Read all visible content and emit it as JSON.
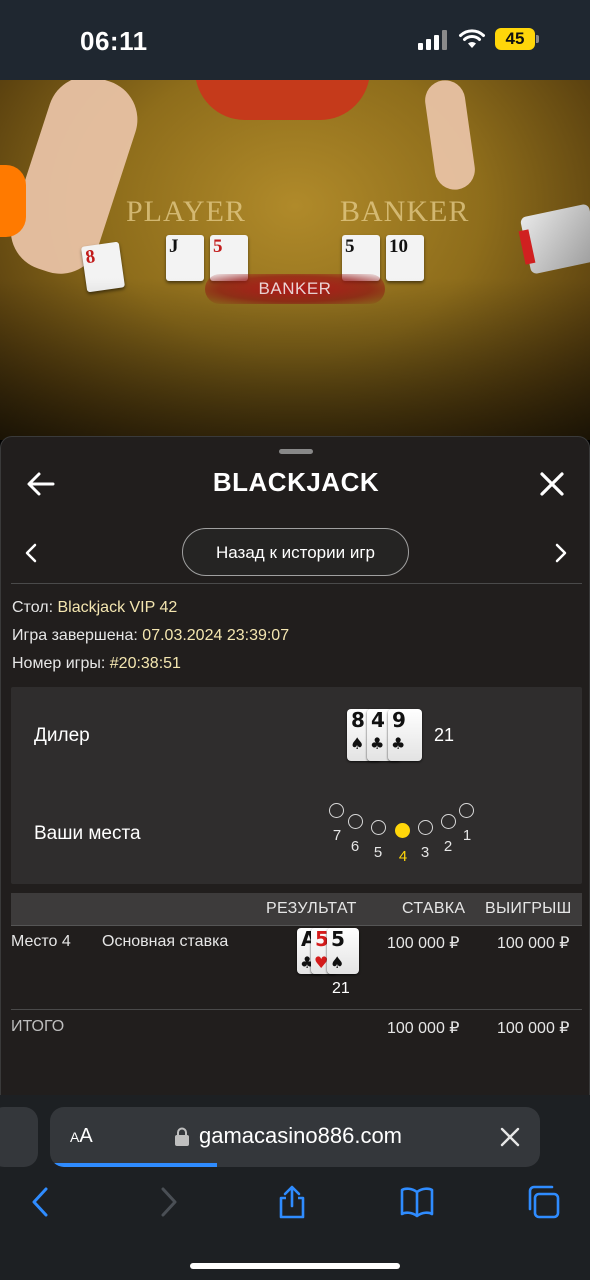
{
  "status_bar": {
    "time": "06:11",
    "battery": "45"
  },
  "video": {
    "player_label": "PLAYER",
    "banker_label": "BANKER",
    "result_banner": "BANKER",
    "cards": [
      {
        "text": "8",
        "color": "red"
      },
      {
        "text": "J",
        "color": "black"
      },
      {
        "text": "5",
        "color": "red"
      },
      {
        "text": "5",
        "color": "black"
      },
      {
        "text": "10",
        "color": "black"
      }
    ]
  },
  "panel": {
    "title": "BLACKJACK",
    "history_button": "Назад к истории игр",
    "info": {
      "table_label": "Стол:",
      "table_value": "Blackjack VIP 42",
      "finished_label": "Игра завершена:",
      "finished_value": "07.03.2024 23:39:07",
      "game_no_label": "Номер игры:",
      "game_no_value": "#20:38:51"
    },
    "dealer": {
      "label": "Дилер",
      "cards": [
        {
          "rank": "8",
          "suit": "♠",
          "color": "black"
        },
        {
          "rank": "4",
          "suit": "♣",
          "color": "black"
        },
        {
          "rank": "9",
          "suit": "♣",
          "color": "black"
        }
      ],
      "score": "21"
    },
    "seats": {
      "label": "Ваши места",
      "items": [
        "7",
        "6",
        "5",
        "4",
        "3",
        "2",
        "1"
      ],
      "active": "4"
    },
    "table": {
      "headers": {
        "result": "РЕЗУЛЬТАТ",
        "bet": "СТАВКА",
        "win": "ВЫИГРЫШ"
      },
      "row": {
        "seat": "Место 4",
        "bet_type": "Основная ставка",
        "cards": [
          {
            "rank": "A",
            "suit": "♣",
            "color": "black"
          },
          {
            "rank": "5",
            "suit": "♥",
            "color": "red"
          },
          {
            "rank": "5",
            "suit": "♠",
            "color": "black"
          }
        ],
        "score": "21",
        "bet": "100 000 ₽",
        "win": "100 000 ₽"
      },
      "total": {
        "label": "ИТОГО",
        "bet": "100 000 ₽",
        "win": "100 000 ₽"
      }
    }
  },
  "browser": {
    "aa_small": "A",
    "aa_large": "A",
    "url": "gamacasino886.com",
    "load_progress": 0.34
  },
  "icons": {
    "back": "arrow-left-icon",
    "close": "close-icon",
    "prev": "chevron-left-icon",
    "next": "chevron-right-icon",
    "lock": "lock-icon",
    "share": "share-icon",
    "bookmarks": "book-icon",
    "tabs": "tabs-icon"
  },
  "colors": {
    "accent_yellow": "#ffd60a",
    "safari_blue": "#2f8cff",
    "live_orange": "#ff7a00"
  }
}
